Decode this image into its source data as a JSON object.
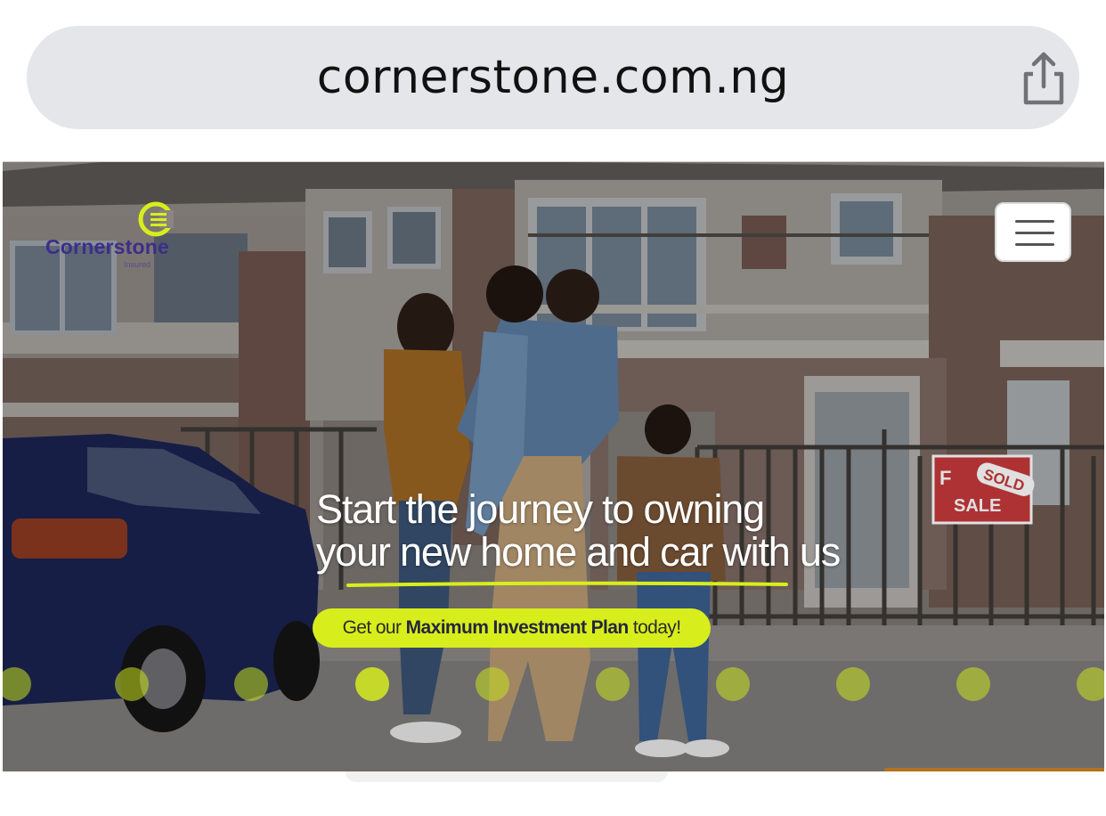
{
  "browser": {
    "url": "cornerstone.com.ng",
    "share_icon": "share-icon"
  },
  "header": {
    "logo_name": "Cornerstone",
    "logo_tagline": "Insured",
    "logo_icon": "cornerstone-c-icon",
    "menu_icon": "hamburger-menu-icon"
  },
  "hero": {
    "headline_line1": "Start the journey to owning",
    "headline_line2": "your new home and car with us",
    "cta_prefix": "Get our ",
    "cta_bold": "Maximum Investment Plan",
    "cta_suffix": " today!",
    "sign_text_1": "F",
    "sign_text_2": "SALE",
    "sign_sold": "SOLD",
    "slide_count": 10,
    "active_slide": 3
  },
  "colors": {
    "accent_lime": "#d8ee1c",
    "brand_purple": "#3d2d8c",
    "urlbar_bg": "#e4e6ea"
  }
}
